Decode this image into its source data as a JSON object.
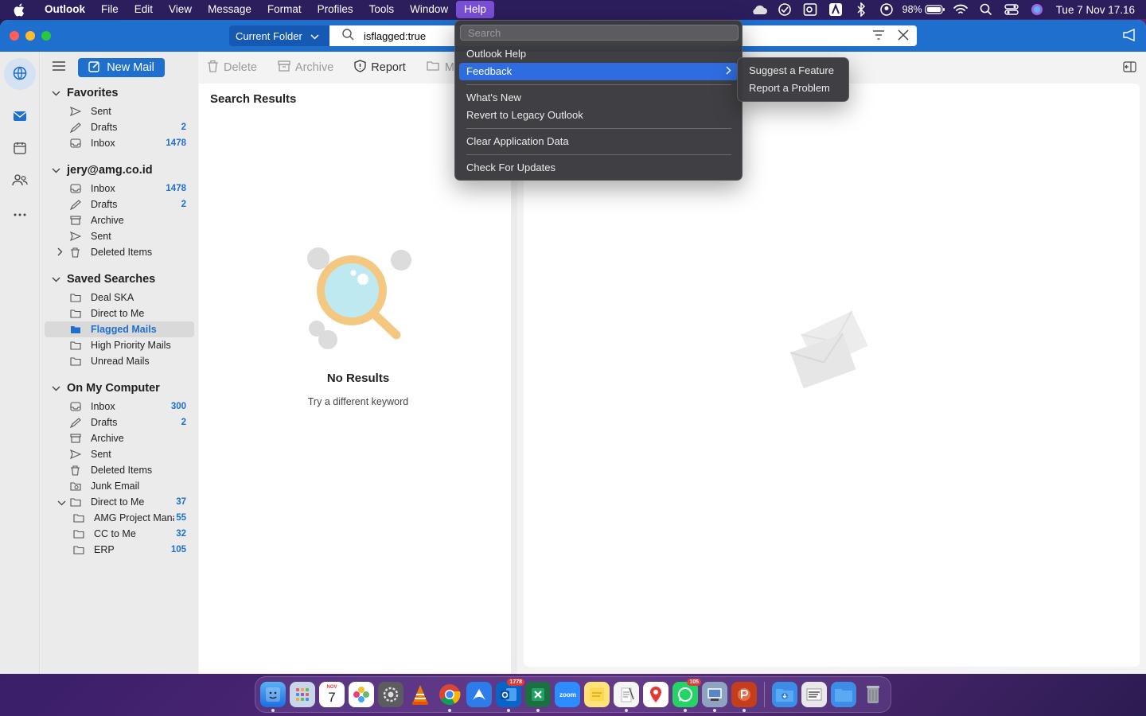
{
  "menubar": {
    "app_name": "Outlook",
    "items": [
      "File",
      "Edit",
      "View",
      "Message",
      "Format",
      "Profiles",
      "Tools",
      "Window",
      "Help"
    ],
    "active_item": "Help",
    "battery": "98%",
    "clock": "Tue 7 Nov  17.16"
  },
  "titlebar": {
    "scope_label": "Current Folder",
    "search_value": "isflagged:true"
  },
  "toolbar": {
    "new_mail": "New Mail",
    "delete": "Delete",
    "archive": "Archive",
    "report": "Report",
    "move_partial": "M"
  },
  "folders": {
    "favorites": {
      "title": "Favorites",
      "items": [
        {
          "label": "Sent",
          "count": ""
        },
        {
          "label": "Drafts",
          "count": "2"
        },
        {
          "label": "Inbox",
          "count": "1478"
        }
      ]
    },
    "account": {
      "title": "jery@amg.co.id",
      "items": [
        {
          "label": "Inbox",
          "count": "1478"
        },
        {
          "label": "Drafts",
          "count": "2"
        },
        {
          "label": "Archive",
          "count": ""
        },
        {
          "label": "Sent",
          "count": ""
        },
        {
          "label": "Deleted Items",
          "count": ""
        }
      ]
    },
    "saved_searches": {
      "title": "Saved Searches",
      "items": [
        {
          "label": "Deal SKA"
        },
        {
          "label": "Direct to Me"
        },
        {
          "label": "Flagged Mails"
        },
        {
          "label": "High Priority Mails"
        },
        {
          "label": "Unread Mails"
        }
      ],
      "selected": "Flagged Mails"
    },
    "on_my_computer": {
      "title": "On My Computer",
      "items": [
        {
          "label": "Inbox",
          "count": "300"
        },
        {
          "label": "Drafts",
          "count": "2"
        },
        {
          "label": "Archive",
          "count": ""
        },
        {
          "label": "Sent",
          "count": ""
        },
        {
          "label": "Deleted Items",
          "count": ""
        },
        {
          "label": "Junk Email",
          "count": ""
        },
        {
          "label": "Direct to Me",
          "count": "37"
        },
        {
          "label": "AMG Project Manag",
          "count": "55"
        },
        {
          "label": "CC to Me",
          "count": "32"
        },
        {
          "label": "ERP",
          "count": "105"
        }
      ]
    }
  },
  "message_list": {
    "header": "Search Results",
    "empty_title": "No Results",
    "empty_subtitle": "Try a different keyword"
  },
  "help_menu": {
    "search_placeholder": "Search",
    "items": [
      "Outlook Help",
      "Feedback",
      "What's New",
      "Revert to Legacy Outlook",
      "Clear Application Data",
      "Check For Updates"
    ],
    "highlighted": "Feedback"
  },
  "feedback_submenu": {
    "items": [
      "Suggest a Feature",
      "Report a Problem"
    ]
  },
  "dock": {
    "calendar_month": "NOV",
    "calendar_day": "7",
    "outlook_badge": "1778",
    "whatsapp_badge": "105"
  },
  "colors": {
    "accent": "#1f6fcf",
    "menu_highlight": "#2e6de0",
    "menubar_bg": "#2c1d5d",
    "count_blue": "#1f6fcf"
  }
}
